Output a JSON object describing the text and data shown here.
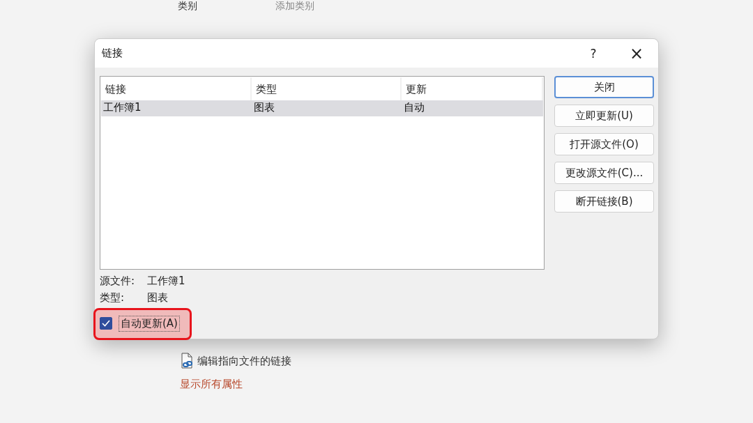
{
  "page": {
    "category_label": "类别",
    "category_value": "添加类别",
    "edit_link": "编辑指向文件的链接",
    "show_all": "显示所有属性"
  },
  "dialog": {
    "title": "链接",
    "help": "?",
    "close": "×",
    "table": {
      "columns": [
        "链接",
        "类型",
        "更新"
      ],
      "rows": [
        {
          "cells": [
            "工作簿1",
            "图表",
            "自动"
          ],
          "selected": true
        }
      ]
    },
    "buttons": [
      {
        "label": "关闭",
        "default": true
      },
      {
        "label": "立即更新(U)",
        "default": false
      },
      {
        "label": "打开源文件(O)",
        "default": false
      },
      {
        "label": "更改源文件(C)...",
        "default": false
      },
      {
        "label": "断开链接(B)",
        "default": false
      }
    ],
    "info": [
      {
        "label": "源文件:",
        "value": "工作簿1"
      },
      {
        "label": "类型:",
        "value": "图表"
      }
    ],
    "auto_update": {
      "label": "自动更新(A)",
      "checked": true,
      "highlighted": true
    }
  }
}
